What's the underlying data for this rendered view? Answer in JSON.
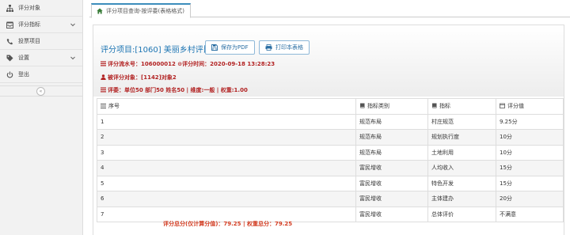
{
  "sidebar": {
    "items": [
      {
        "label": "评分对象",
        "icon": "sitemap-icon",
        "has_chevron": false
      },
      {
        "label": "评分指标",
        "icon": "inbox-icon",
        "has_chevron": true
      },
      {
        "label": "投票项目",
        "icon": "phone-icon",
        "has_chevron": false
      },
      {
        "label": "设置",
        "icon": "tag-icon",
        "has_chevron": true
      },
      {
        "label": "登出",
        "icon": "power-icon",
        "has_chevron": false
      }
    ],
    "collapse_glyph": "«"
  },
  "tab": {
    "label": "评分项目查询-按评委(表格格式)"
  },
  "header": {
    "title": "评分项目:[1060] 美丽乡村评比",
    "save_pdf_label": "保存为PDF",
    "print_label": "打印本表格",
    "serial_line": "评分流水号：106000012 ⊙评分时间：2020-09-18 13:28:23",
    "target_line": "被评分对象：[1142]对象2",
    "judge_line": "评委：单位50 部门50 姓名50 | 维度:一般 | 权重:1.00"
  },
  "table": {
    "headers": [
      "序号",
      "指标类别",
      "指标",
      "评分值"
    ],
    "rows": [
      [
        "1",
        "规范布局",
        "村庄规范",
        "9.25分"
      ],
      [
        "2",
        "规范布局",
        "规划执行度",
        "10分"
      ],
      [
        "3",
        "规范布局",
        "土地利用",
        "10分"
      ],
      [
        "4",
        "富民增收",
        "人均收入",
        "15分"
      ],
      [
        "5",
        "富民增收",
        "特色开发",
        "15分"
      ],
      [
        "6",
        "富民增收",
        "主体建办",
        "20分"
      ],
      [
        "7",
        "富民增收",
        "总体评价",
        "不满意"
      ]
    ]
  },
  "total": "评分总分(仅计算分值)：79.25 | 权重总分：79.25",
  "colors": {
    "accent": "#3c8dbc",
    "title": "#1d75b3",
    "info_red": "#b22222"
  }
}
